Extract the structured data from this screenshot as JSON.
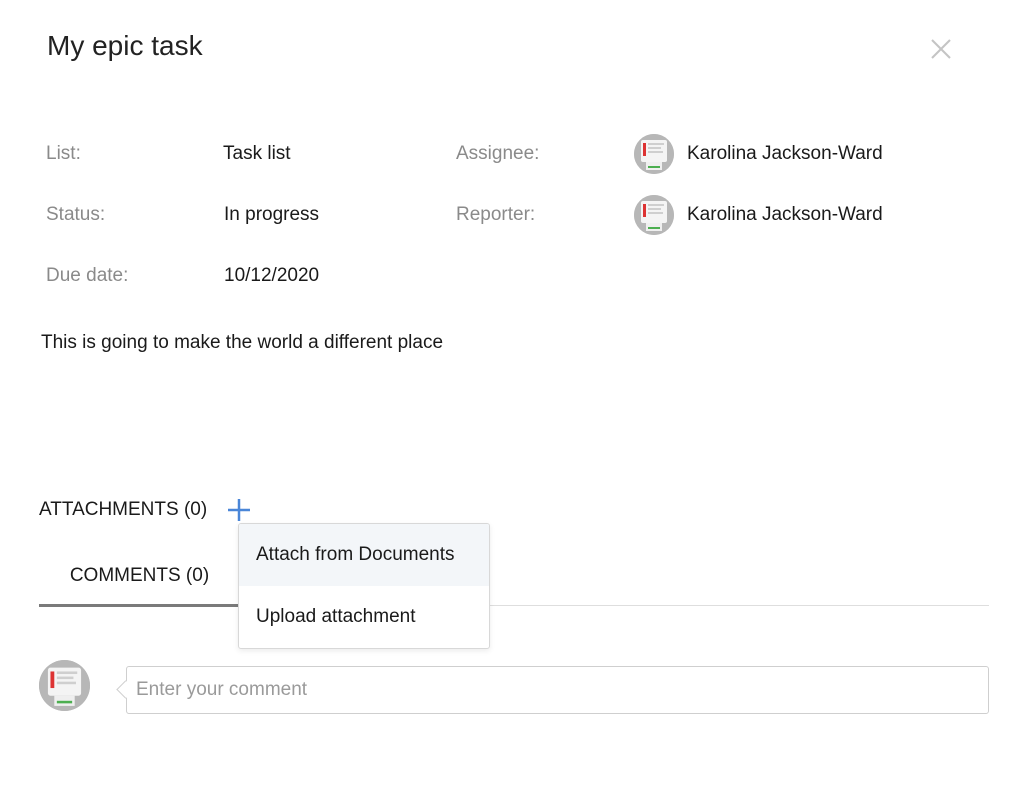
{
  "task": {
    "title": "My epic task",
    "description": "This is going to make the world a different place"
  },
  "fields": {
    "list_label": "List:",
    "list_value": "Task list",
    "status_label": "Status:",
    "status_value": "In progress",
    "due_label": "Due date:",
    "due_value": "10/12/2020",
    "assignee_label": "Assignee:",
    "assignee_name": "Karolina Jackson-Ward",
    "reporter_label": "Reporter:",
    "reporter_name": "Karolina Jackson-Ward"
  },
  "attachments": {
    "label": "ATTACHMENTS (0)",
    "menu": [
      {
        "label": "Attach from Documents"
      },
      {
        "label": "Upload attachment"
      }
    ]
  },
  "tabs": [
    {
      "label": "COMMENTS (0)",
      "active": true
    }
  ],
  "comment": {
    "placeholder": "Enter your comment",
    "value": ""
  },
  "icons": {
    "close": "close-icon",
    "add": "plus-icon",
    "avatar": "user-avatar"
  },
  "colors": {
    "accent": "#4a86d8",
    "label_gray": "#8a8a8a",
    "tab_underline": "#7a7a7a"
  }
}
